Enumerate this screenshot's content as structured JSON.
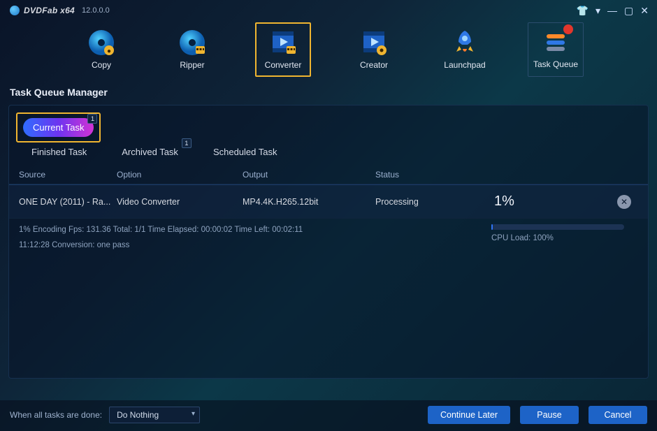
{
  "colors": {
    "accent_yellow": "#f0b530",
    "accent_blue": "#2f74f5",
    "btn": "#1d63c7",
    "badge_red": "#e2362c"
  },
  "titlebar": {
    "app_name": "DVDFab x64",
    "version": "12.0.0.0",
    "icons": {
      "shirt": "👕",
      "dropdown": "▾",
      "minimize": "—",
      "restore": "▢",
      "close": "✕"
    }
  },
  "topnav": [
    {
      "id": "copy",
      "label": "Copy"
    },
    {
      "id": "ripper",
      "label": "Ripper"
    },
    {
      "id": "converter",
      "label": "Converter",
      "highlighted": true
    },
    {
      "id": "creator",
      "label": "Creator"
    },
    {
      "id": "launchpad",
      "label": "Launchpad"
    },
    {
      "id": "taskqueue",
      "label": "Task Queue",
      "selected": true,
      "badge_red": true
    }
  ],
  "section_title": "Task Queue Manager",
  "tabs": [
    {
      "id": "current",
      "label": "Current Task",
      "active": true,
      "badge": "1"
    },
    {
      "id": "finished",
      "label": "Finished Task"
    },
    {
      "id": "archived",
      "label": "Archived Task",
      "badge": "1"
    },
    {
      "id": "scheduled",
      "label": "Scheduled Task"
    }
  ],
  "columns": {
    "source": "Source",
    "option": "Option",
    "output": "Output",
    "status": "Status"
  },
  "task": {
    "source": "ONE DAY (2011) - Ra...",
    "option": "Video Converter",
    "output": "MP4.4K.H265.12bit",
    "status": "Processing",
    "percent": "1%",
    "close_glyph": "✕"
  },
  "progress": {
    "line1": "1%  Encoding Fps: 131.36  Total: 1/1 Time Elapsed: 00:00:02 Time Left: 00:02:11",
    "line2": "11:12:28  Conversion: one pass",
    "cpu_load": "CPU Load: 100%",
    "bar_percent": 1
  },
  "footer": {
    "label": "When all tasks are done:",
    "select_value": "Do Nothing",
    "buttons": {
      "continue": "Continue Later",
      "pause": "Pause",
      "cancel": "Cancel"
    }
  }
}
